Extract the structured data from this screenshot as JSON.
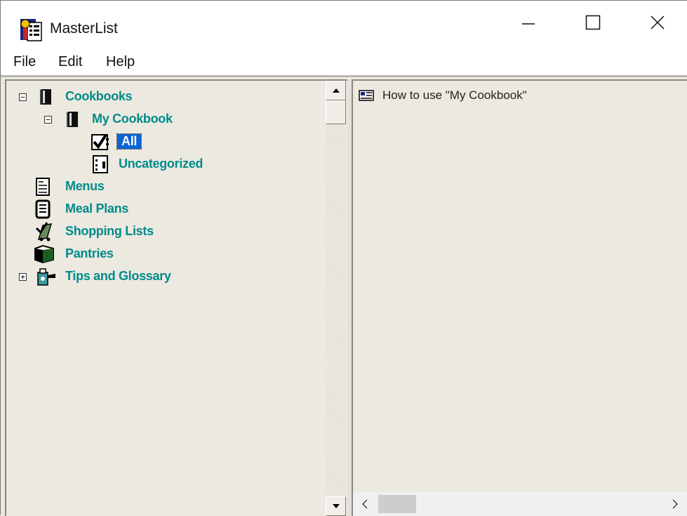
{
  "window": {
    "title": "MasterList",
    "icon": "masterlist-app-icon"
  },
  "menu": {
    "items": [
      "File",
      "Edit",
      "Help"
    ]
  },
  "tree": {
    "nodes": [
      {
        "label": "Cookbooks",
        "icon": "book-icon",
        "expander": "⊟",
        "expanded": true
      },
      {
        "label": "My Cookbook",
        "icon": "book-icon",
        "expander": "⊟",
        "expanded": true
      },
      {
        "label": "All",
        "icon": "checklist-icon",
        "selected": true
      },
      {
        "label": "Uncategorized",
        "icon": "notebook-icon"
      },
      {
        "label": "Menus",
        "icon": "menu-card-icon"
      },
      {
        "label": "Meal Plans",
        "icon": "meal-plan-icon"
      },
      {
        "label": "Shopping Lists",
        "icon": "shopping-list-icon"
      },
      {
        "label": "Pantries",
        "icon": "pantry-icon"
      },
      {
        "label": "Tips and Glossary",
        "icon": "tips-icon",
        "expander": "⊞",
        "expanded": false
      }
    ]
  },
  "content": {
    "items": [
      {
        "label": "How to use \"My Cookbook\"",
        "icon": "document-icon"
      }
    ]
  }
}
